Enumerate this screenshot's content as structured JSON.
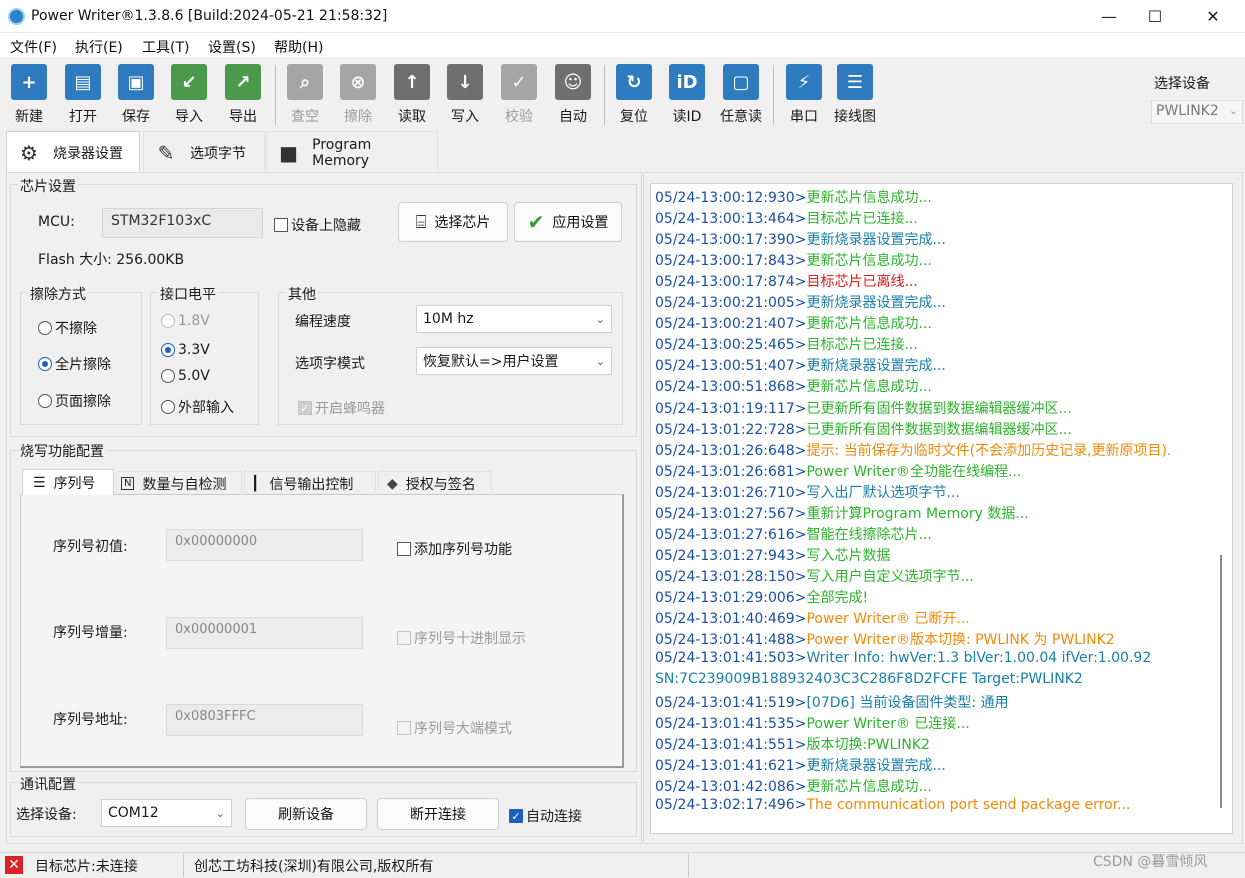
{
  "window": {
    "title": "Power Writer®1.3.8.6 [Build:2024-05-21 21:58:32]",
    "controls": [
      "—",
      "☐",
      "✕"
    ]
  },
  "menu": [
    "文件(F)",
    "执行(E)",
    "工具(T)",
    "设置(S)",
    "帮助(H)"
  ],
  "toolbar": {
    "buttons": [
      {
        "label": "新建",
        "icon": "new-icon",
        "glyph": "+",
        "color": "#2f7bbf",
        "enabled": true
      },
      {
        "label": "打开",
        "icon": "open-icon",
        "glyph": "▤",
        "color": "#2f7bbf",
        "enabled": true
      },
      {
        "label": "保存",
        "icon": "save-icon",
        "glyph": "▣",
        "color": "#2f7bbf",
        "enabled": true
      },
      {
        "label": "导入",
        "icon": "import-icon",
        "glyph": "↙",
        "color": "#4b9a4b",
        "enabled": true
      },
      {
        "label": "导出",
        "icon": "export-icon",
        "glyph": "↗",
        "color": "#4b9a4b",
        "enabled": true
      },
      {
        "label": "查空",
        "icon": "blank-check-icon",
        "glyph": "⌕",
        "color": "#8c8c8c",
        "enabled": false
      },
      {
        "label": "擦除",
        "icon": "erase-icon",
        "glyph": "⊗",
        "color": "#8c8c8c",
        "enabled": false
      },
      {
        "label": "读取",
        "icon": "read-icon",
        "glyph": "↑",
        "color": "#6f6f6f",
        "enabled": true
      },
      {
        "label": "写入",
        "icon": "write-icon",
        "glyph": "↓",
        "color": "#6f6f6f",
        "enabled": true
      },
      {
        "label": "校验",
        "icon": "verify-icon",
        "glyph": "✓",
        "color": "#8c8c8c",
        "enabled": false
      },
      {
        "label": "自动",
        "icon": "auto-robot-icon",
        "glyph": "☺",
        "color": "#6f6f6f",
        "enabled": true
      },
      {
        "label": "复位",
        "icon": "reset-icon",
        "glyph": "↻",
        "color": "#2f7bbf",
        "enabled": true
      },
      {
        "label": "读ID",
        "icon": "read-id-icon",
        "glyph": "iD",
        "color": "#2f7bbf",
        "enabled": true
      },
      {
        "label": "任意读",
        "icon": "random-read-icon",
        "glyph": "▢",
        "color": "#2f7bbf",
        "enabled": true
      },
      {
        "label": "串口",
        "icon": "serial-port-icon",
        "glyph": "⚡",
        "color": "#2f7bbf",
        "enabled": true
      },
      {
        "label": "接线图",
        "icon": "wiring-diagram-icon",
        "glyph": "☰",
        "color": "#2f7bbf",
        "enabled": true
      }
    ],
    "device_label": "选择设备",
    "device_value": "PWLINK2"
  },
  "tabs": [
    {
      "label": "烧录器设置",
      "icon": "gear-icon",
      "glyph": "⚙"
    },
    {
      "label": "选项字节",
      "icon": "option-bytes-icon",
      "glyph": "✎"
    },
    {
      "label": "Program Memory",
      "icon": "program-memory-icon",
      "glyph": "■"
    }
  ],
  "chip": {
    "legend": "芯片设置",
    "mcu_label": "MCU:",
    "mcu_value": "STM32F103xC",
    "hide_on_device": "设备上隐藏",
    "select_chip": "选择芯片",
    "apply": "应用设置",
    "flash": "Flash 大小: 256.00KB"
  },
  "erase": {
    "legend": "擦除方式",
    "options": [
      "不擦除",
      "全片擦除",
      "页面擦除"
    ],
    "selected": 1
  },
  "voltage": {
    "legend": "接口电平",
    "options": [
      "1.8V",
      "3.3V",
      "5.0V",
      "外部输入"
    ],
    "selected": 1
  },
  "other": {
    "legend": "其他",
    "speed_label": "编程速度",
    "speed_value": "10M hz",
    "mode_label": "选项字模式",
    "mode_value": "恢复默认=>用户设置",
    "buzzer": "开启蜂鸣器"
  },
  "burn": {
    "legend": "烧写功能配置",
    "subtabs": [
      {
        "label": "序列号",
        "glyph": "☰"
      },
      {
        "label": "数量与自检测",
        "glyph": "N"
      },
      {
        "label": "信号输出控制",
        "glyph": "┃"
      },
      {
        "label": "授权与签名",
        "glyph": "◆"
      }
    ],
    "serial_init_label": "序列号初值:",
    "serial_init_value": "0x00000000",
    "serial_inc_label": "序列号增量:",
    "serial_inc_value": "0x00000001",
    "serial_addr_label": "序列号地址:",
    "serial_addr_value": "0x0803FFFC",
    "add_serial": "添加序列号功能",
    "decimal": "序列号十进制显示",
    "big_endian": "序列号大端模式"
  },
  "comm": {
    "legend": "通讯配置",
    "select_label": "选择设备:",
    "port": "COM12",
    "refresh": "刷新设备",
    "disconnect": "断开连接",
    "auto": "自动连接"
  },
  "colors": {
    "green": "#2db52d",
    "red": "#e21b1b",
    "orange": "#f08a0c",
    "blue": "#1a4fa3",
    "teal": "#1a7fa8"
  },
  "log": [
    {
      "ts": "05/24-13:00:12:930>",
      "msg": "更新芯片信息成功...",
      "color": "green"
    },
    {
      "ts": "05/24-13:00:13:464>",
      "msg": "目标芯片已连接...",
      "color": "green"
    },
    {
      "ts": "05/24-13:00:17:390>",
      "msg": "更新烧录器设置完成...",
      "color": "teal"
    },
    {
      "ts": "05/24-13:00:17:843>",
      "msg": "更新芯片信息成功...",
      "color": "green"
    },
    {
      "ts": "05/24-13:00:17:874>",
      "msg": "目标芯片已离线...",
      "color": "red"
    },
    {
      "ts": "05/24-13:00:21:005>",
      "msg": "更新烧录器设置完成...",
      "color": "teal"
    },
    {
      "ts": "05/24-13:00:21:407>",
      "msg": "更新芯片信息成功...",
      "color": "green"
    },
    {
      "ts": "05/24-13:00:25:465>",
      "msg": "目标芯片已连接...",
      "color": "green"
    },
    {
      "ts": "05/24-13:00:51:407>",
      "msg": "更新烧录器设置完成...",
      "color": "teal"
    },
    {
      "ts": "05/24-13:00:51:868>",
      "msg": "更新芯片信息成功...",
      "color": "green"
    },
    {
      "ts": "05/24-13:01:19:117>",
      "msg": "已更新所有固件数据到数据编辑器缓冲区...",
      "color": "green"
    },
    {
      "ts": "05/24-13:01:22:728>",
      "msg": "已更新所有固件数据到数据编辑器缓冲区...",
      "color": "green"
    },
    {
      "ts": "05/24-13:01:26:648>",
      "msg": "提示: 当前保存为临时文件(不会添加历史记录,更新原项目).",
      "color": "orange"
    },
    {
      "ts": "05/24-13:01:26:681>",
      "msg": "Power Writer®全功能在线编程...",
      "color": "green"
    },
    {
      "ts": "05/24-13:01:26:710>",
      "msg": "写入出厂默认选项字节...",
      "color": "teal"
    },
    {
      "ts": "05/24-13:01:27:567>",
      "msg": "重新计算Program Memory 数据...",
      "color": "green"
    },
    {
      "ts": "05/24-13:01:27:616>",
      "msg": "智能在线擦除芯片...",
      "color": "green"
    },
    {
      "ts": "05/24-13:01:27:943>",
      "msg": "写入芯片数据",
      "color": "green"
    },
    {
      "ts": "05/24-13:01:28:150>",
      "msg": "写入用户自定义选项字节...",
      "color": "green"
    },
    {
      "ts": "05/24-13:01:29:006>",
      "msg": "全部完成!",
      "color": "green"
    },
    {
      "ts": "05/24-13:01:40:469>",
      "msg": "Power Writer® 已断开...",
      "color": "orange"
    },
    {
      "ts": "05/24-13:01:41:488>",
      "msg": "Power Writer®版本切换: PWLINK 为 PWLINK2",
      "color": "orange"
    },
    {
      "ts": "05/24-13:01:41:503>",
      "msg": "Writer Info:  hwVer:1.3   blVer:1.00.04   ifVer:1.00.92",
      "color": "teal"
    },
    {
      "ts": "",
      "msg": "SN:7C239009B188932403C3C286F8D2FCFE Target:PWLINK2",
      "color": "teal"
    },
    {
      "ts": "05/24-13:01:41:519>",
      "msg": "[07D6] 当前设备固件类型: 通用",
      "color": "teal"
    },
    {
      "ts": "05/24-13:01:41:535>",
      "msg": "Power Writer® 已连接...",
      "color": "green"
    },
    {
      "ts": "05/24-13:01:41:551>",
      "msg": "版本切换:PWLINK2",
      "color": "green"
    },
    {
      "ts": "05/24-13:01:41:621>",
      "msg": "更新烧录器设置完成...",
      "color": "teal"
    },
    {
      "ts": "05/24-13:01:42:086>",
      "msg": "更新芯片信息成功...",
      "color": "green"
    },
    {
      "ts": "05/24-13:02:17:496>",
      "msg": "The communication port send package error...",
      "color": "orange"
    }
  ],
  "status": {
    "target": "目标芯片:未连接",
    "company": "创芯工坊科技(深圳)有限公司,版权所有",
    "watermark": "CSDN @暮雪倾风"
  }
}
